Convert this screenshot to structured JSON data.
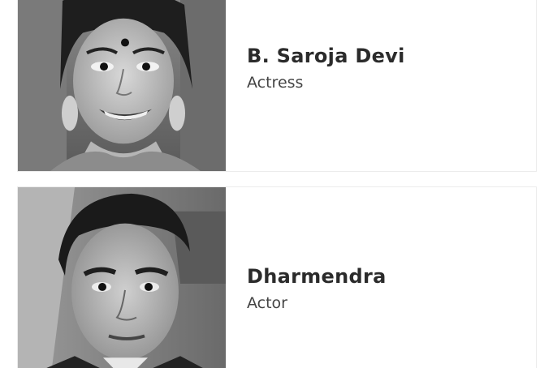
{
  "people": [
    {
      "name": "B. Saroja Devi",
      "role": "Actress"
    },
    {
      "name": "Dharmendra",
      "role": "Actor"
    }
  ]
}
